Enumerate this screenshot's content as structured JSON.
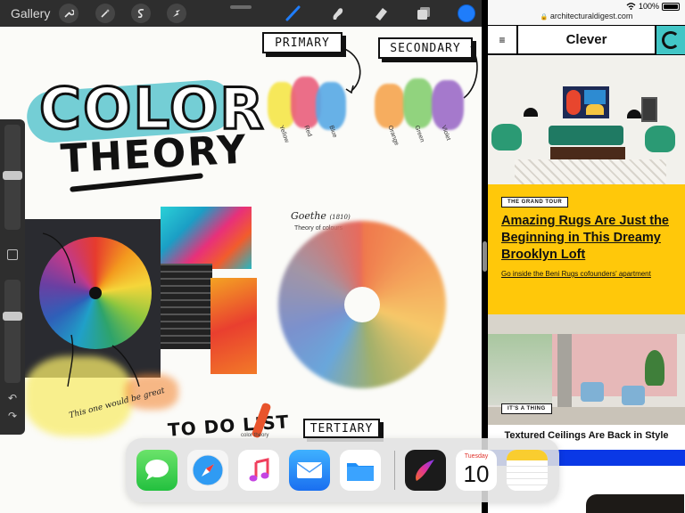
{
  "procreate": {
    "gallery_label": "Gallery",
    "toolbar_icons": [
      "wrench-icon",
      "magic-wand-icon",
      "selection-icon",
      "transform-arrow-icon",
      "brush-icon",
      "smudge-icon",
      "eraser-icon",
      "layers-icon"
    ],
    "active_color": "#1f7dfb",
    "canvas": {
      "title_word1": "COLOR",
      "title_word2": "THEORY",
      "primary_label": "PRIMARY",
      "secondary_label": "SECONDARY",
      "tertiary_label": "TERTIARY",
      "primary_swatches": [
        "Yellow",
        "Red",
        "Blue"
      ],
      "secondary_swatches": [
        "Orange",
        "Green",
        "Violet"
      ],
      "goethe_title": "Goethe",
      "goethe_year": "(1810)",
      "goethe_sub": "Theory of colours",
      "todo_label": "TO DO LIST",
      "note_text": "This one would be great",
      "note_small": "color theory"
    }
  },
  "safari": {
    "status": {
      "battery": "100%"
    },
    "url": "architecturaldigest.com",
    "site": {
      "brand": "Clever",
      "menu_icon": "≡",
      "article1": {
        "tag": "THE GRAND TOUR",
        "headline": "Amazing Rugs Are Just the Beginning in This Dreamy Brooklyn Loft",
        "dek": "Go inside the Beni Rugs cofounders' apartment"
      },
      "article2": {
        "tag": "IT'S A THING",
        "headline": "Textured Ceilings Are Back in Style"
      }
    }
  },
  "dock": {
    "apps": [
      "Messages",
      "Safari",
      "Music",
      "Mail",
      "Files",
      "Procreate",
      "Calendar",
      "Notes"
    ],
    "calendar_day": "Tuesday",
    "calendar_date": "10"
  }
}
